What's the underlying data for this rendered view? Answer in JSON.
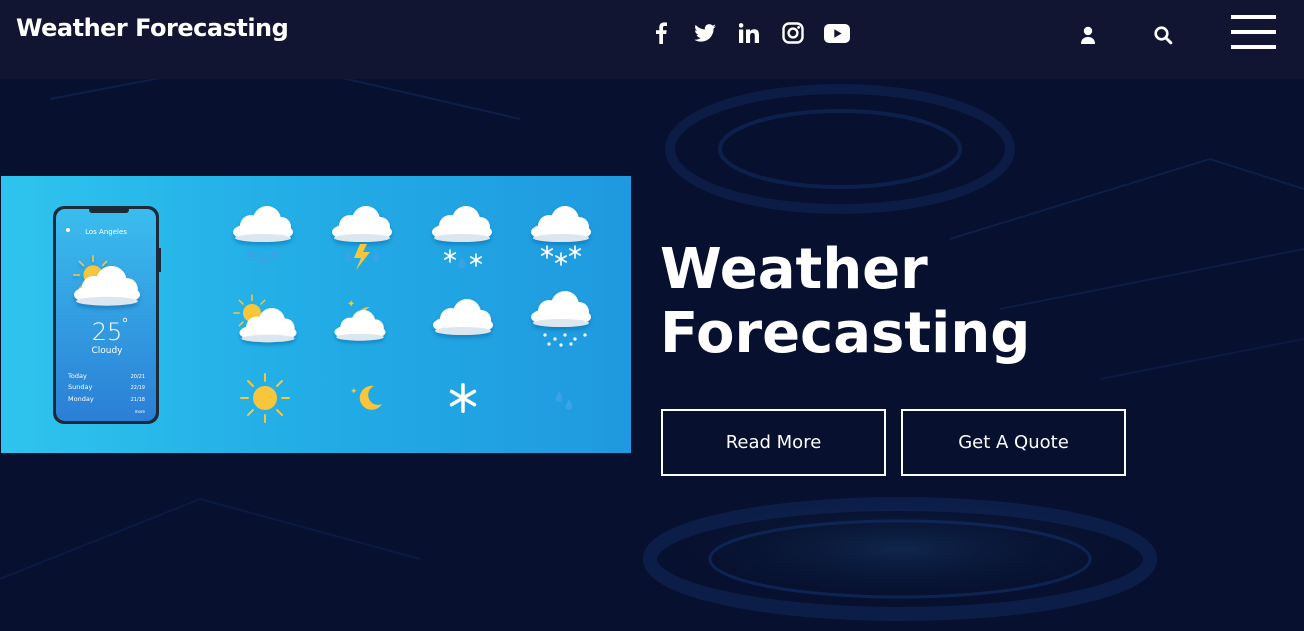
{
  "header": {
    "brand": "Weather Forecasting",
    "social_icons": [
      "facebook-icon",
      "twitter-icon",
      "linkedin-icon",
      "instagram-icon",
      "youtube-icon"
    ],
    "actions": [
      "user-icon",
      "search-icon",
      "hamburger-menu-icon"
    ]
  },
  "hero": {
    "title_line1": "Weather",
    "title_line2": "Forecasting",
    "read_more_label": "Read More",
    "quote_label": "Get A Quote",
    "image": {
      "phone": {
        "city": "Los Angeles",
        "temperature": "25",
        "condition": "Cloudy",
        "forecast": [
          {
            "day": "Today",
            "range": "20/21"
          },
          {
            "day": "Sunday",
            "range": "22/19"
          },
          {
            "day": "Monday",
            "range": "21/18"
          }
        ],
        "more": "more"
      },
      "weather_icons": [
        "rain-cloud-icon",
        "thunderstorm-icon",
        "snow-rain-icon",
        "snow-cloud-icon",
        "partly-sunny-icon",
        "night-cloud-icon",
        "cloud-icon",
        "hail-icon",
        "sun-icon",
        "moon-icon",
        "snowflake-icon",
        "raindrops-icon"
      ]
    }
  },
  "colors": {
    "topbar": "#111531",
    "background": "#07102e",
    "image_gradient_start": "#2fc4ee",
    "image_gradient_end": "#1f99df",
    "sun": "#f9c53b"
  }
}
